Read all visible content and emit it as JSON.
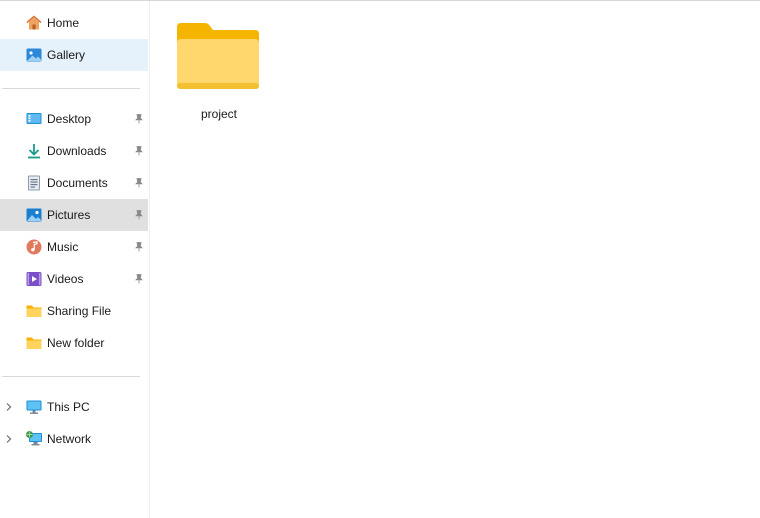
{
  "sidebar": {
    "quick": [
      {
        "id": "home",
        "label": "Home",
        "icon": "home-icon",
        "state": "normal"
      },
      {
        "id": "gallery",
        "label": "Gallery",
        "icon": "gallery-icon",
        "state": "selected"
      }
    ],
    "pinned": [
      {
        "id": "desktop",
        "label": "Desktop",
        "icon": "desktop-icon",
        "pinned": true
      },
      {
        "id": "downloads",
        "label": "Downloads",
        "icon": "download-icon",
        "pinned": true
      },
      {
        "id": "documents",
        "label": "Documents",
        "icon": "document-icon",
        "pinned": true
      },
      {
        "id": "pictures",
        "label": "Pictures",
        "icon": "pictures-icon",
        "pinned": true,
        "state": "hovered"
      },
      {
        "id": "music",
        "label": "Music",
        "icon": "music-icon",
        "pinned": true
      },
      {
        "id": "videos",
        "label": "Videos",
        "icon": "video-icon",
        "pinned": true
      },
      {
        "id": "sharing-file",
        "label": "Sharing File",
        "icon": "folder-icon",
        "pinned": false
      },
      {
        "id": "new-folder",
        "label": "New folder",
        "icon": "folder-icon",
        "pinned": false
      }
    ],
    "devices": [
      {
        "id": "this-pc",
        "label": "This PC",
        "icon": "computer-icon",
        "expandable": true
      },
      {
        "id": "network",
        "label": "Network",
        "icon": "network-icon",
        "expandable": true
      }
    ]
  },
  "content": {
    "items": [
      {
        "name": "project",
        "type": "folder",
        "icon": "folder-icon"
      }
    ]
  },
  "colors": {
    "selected_bg": "#e5f1fb",
    "hover_bg": "#e0e0e0",
    "folder_yellow": "#ffd04a",
    "folder_dark": "#f4b400"
  }
}
